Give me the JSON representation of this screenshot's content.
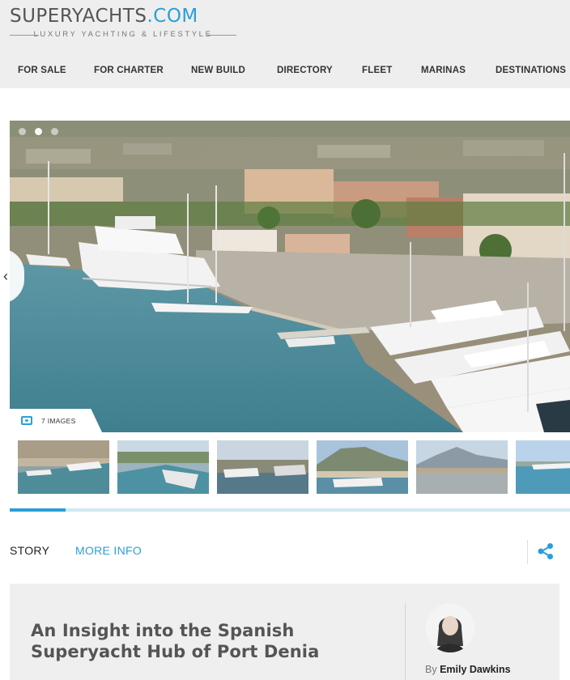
{
  "brand": {
    "name_main": "SUPERYACHTS",
    "name_domain": ".COM",
    "tagline": "LUXURY YACHTING & LIFESTYLE"
  },
  "nav": {
    "items": [
      "FOR SALE",
      "FOR CHARTER",
      "NEW BUILD",
      "DIRECTORY",
      "FLEET",
      "MARINAS",
      "DESTINATIONS"
    ]
  },
  "gallery": {
    "image_count_label": "7 IMAGES",
    "prev_icon": "‹",
    "active_slide": 2,
    "slide_dots": 3,
    "progress_fraction": 0.1
  },
  "tabs": {
    "story": "STORY",
    "more_info": "MORE INFO"
  },
  "article": {
    "title": "An Insight into the Spanish Superyacht Hub of Port Denia",
    "by_prefix": "By",
    "author": "Emily Dawkins"
  },
  "colors": {
    "accent": "#2a9fd6",
    "header_bg": "#eeeeee",
    "card_bg": "#efefef"
  },
  "icons": [
    "camera-icon",
    "share-icon",
    "chevron-left-icon"
  ]
}
